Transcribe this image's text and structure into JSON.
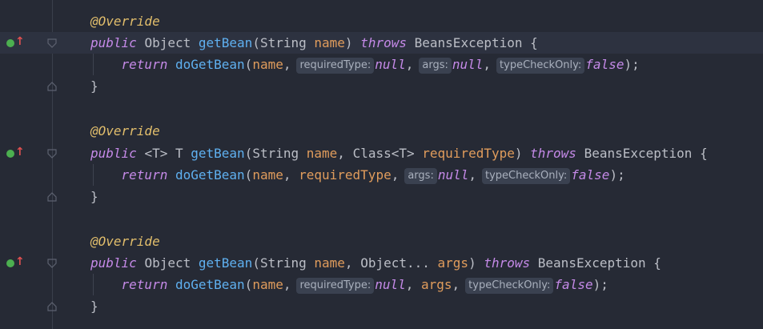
{
  "colors": {
    "background": "#262a35",
    "current_line": "#2d3240",
    "annotation": "#e3bf6c",
    "keyword": "#c58ae8",
    "function": "#5fb0f0",
    "parameter": "#e09c5c",
    "hint_bg": "#3a4150"
  },
  "gutter": {
    "override_icon": "overrides-method-icon",
    "fold_icon": "fold-marker-icon",
    "arrow_glyph": "↑"
  },
  "code": {
    "annotation": "@Override",
    "public": "public",
    "return": "return",
    "throws": "throws",
    "exception": "BeansException",
    "object": "Object",
    "string": "String",
    "getBean": "getBean",
    "doGetBean": "doGetBean",
    "name": "name",
    "null": "null",
    "false": "false",
    "open_brace": " {",
    "close_brace": "}",
    "m1_params_close": ")",
    "m2_generic": "<T> T",
    "m2_class": "Class<T>",
    "m2_required_type": "requiredType",
    "m3_varargs": "Object...",
    "m3_args": "args"
  },
  "hints": {
    "required_type": "requiredType:",
    "args": "args:",
    "type_check_only": "typeCheckOnly:"
  }
}
